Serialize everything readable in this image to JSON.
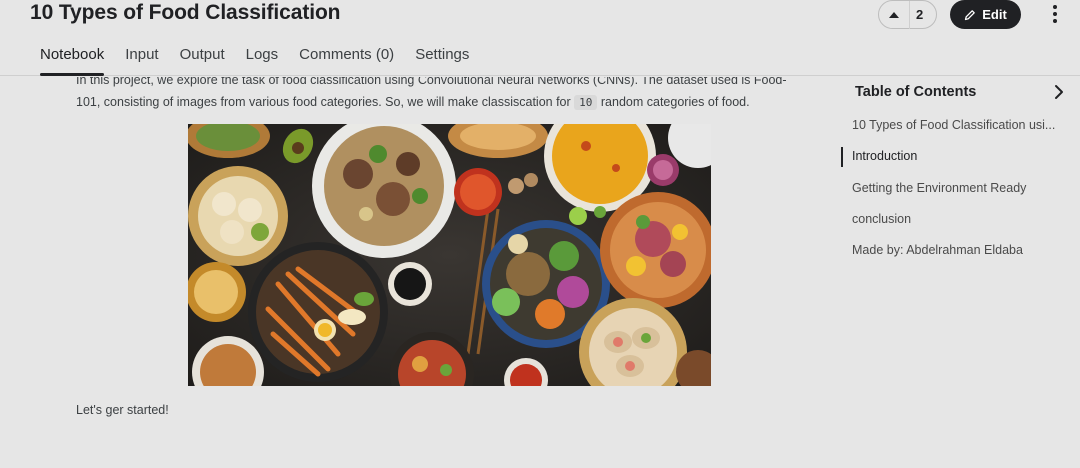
{
  "notebook": {
    "title": "10 Types of Food Classification"
  },
  "actions": {
    "vote_count": "2",
    "edit_label": "Edit"
  },
  "tabs": [
    {
      "label": "Notebook"
    },
    {
      "label": "Input"
    },
    {
      "label": "Output"
    },
    {
      "label": "Logs"
    },
    {
      "label": "Comments (0)"
    },
    {
      "label": "Settings"
    }
  ],
  "content": {
    "intro_line1": "In this project, we explore the task of food classification using Convolutional Neural Networks (CNNs). The dataset used is Food-",
    "intro_line2_a": "101, consisting of images from various food categories. So, we will make classiscation for",
    "intro_code": "10",
    "intro_line2_b": "random categories of food.",
    "closing": "Let's ger started!"
  },
  "toc": {
    "title": "Table of Contents",
    "items": [
      {
        "label": "10 Types of Food Classification usi..."
      },
      {
        "label": "Introduction"
      },
      {
        "label": "Getting the Environment Ready"
      },
      {
        "label": "conclusion"
      },
      {
        "label": "Made by: Abdelrahman Eldaba"
      }
    ],
    "active_index": 1
  },
  "colors": {
    "accent": "#202124",
    "background": "#e6e6e6",
    "text": "#3c4043"
  },
  "icons": {
    "upvote": "caret-up-icon",
    "edit": "pencil-icon",
    "more": "kebab-icon",
    "toc_toggle": "chevron-right-icon"
  }
}
